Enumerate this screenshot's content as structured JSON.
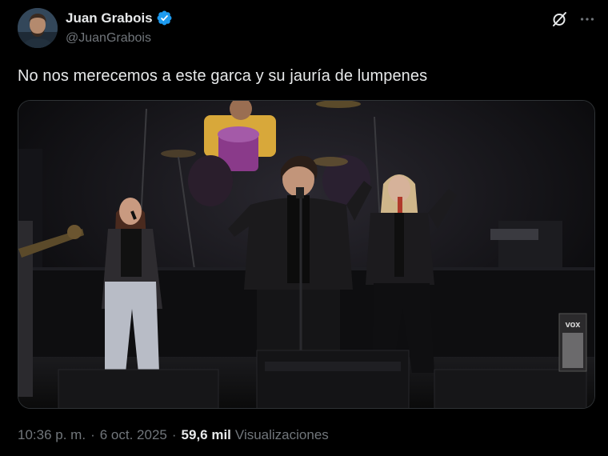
{
  "author": {
    "display_name": "Juan Grabois",
    "handle": "@JuanGrabois",
    "avatar_icon": "person-avatar",
    "verified_icon": "verified-badge-icon",
    "verified_color": "#1d9bf0"
  },
  "header_actions": {
    "grok_icon": "grok-icon",
    "more_icon": "more-options-icon"
  },
  "tweet": {
    "text": "No nos merecemos a este garca y su jauría de lumpenes"
  },
  "media": {
    "type": "photo",
    "speaker_brand": "VOX"
  },
  "footer": {
    "time": "10:36 p. m.",
    "separator": "·",
    "date": "6 oct. 2025",
    "views_count": "59,6 mil",
    "views_label": "Visualizaciones"
  },
  "colors": {
    "background": "#000000",
    "primary_text": "#e7e9ea",
    "secondary_text": "#71767b",
    "accent": "#1d9bf0"
  }
}
